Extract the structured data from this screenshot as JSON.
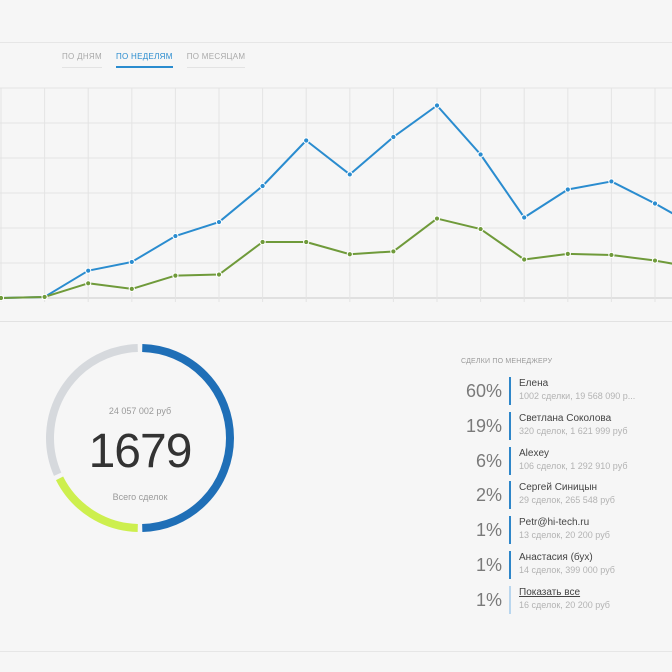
{
  "tabs": [
    {
      "label": "ПО ДНЯМ",
      "active": false
    },
    {
      "label": "ПО НЕДЕЛЯМ",
      "active": true
    },
    {
      "label": "ПО МЕСЯЦАМ",
      "active": false
    }
  ],
  "chart_data": {
    "type": "line",
    "x": [
      1,
      2,
      3,
      4,
      5,
      6,
      7,
      8,
      9,
      10,
      11,
      12,
      13,
      14,
      15,
      16,
      17
    ],
    "ylim": [
      0,
      6
    ],
    "grid": true,
    "series": [
      {
        "color": "#2a8ccf",
        "values": [
          0.0,
          0.03,
          0.78,
          1.03,
          1.77,
          2.17,
          3.2,
          4.5,
          3.53,
          4.6,
          5.5,
          4.1,
          2.3,
          3.1,
          3.33,
          2.7,
          2.0
        ]
      },
      {
        "color": "#6f9a3a",
        "values": [
          0.0,
          0.03,
          0.42,
          0.26,
          0.64,
          0.67,
          1.6,
          1.6,
          1.25,
          1.33,
          2.27,
          1.97,
          1.1,
          1.26,
          1.23,
          1.07,
          0.85
        ]
      }
    ]
  },
  "summary": {
    "amount": "24 057 002 руб",
    "total": "1679",
    "caption": "Всего сделок",
    "donut_segments": [
      {
        "color": "#1f6fb7",
        "fraction": 0.5
      },
      {
        "color": "#cdef4e",
        "fraction": 0.18
      },
      {
        "color": "#d6d9dd",
        "fraction": 0.32
      }
    ]
  },
  "managers": {
    "title": "СДЕЛКИ ПО МЕНЕДЖЕРУ",
    "items": [
      {
        "percent": "60%",
        "name": "Елена",
        "detail": "1002 сделки, 19 568 090 р..."
      },
      {
        "percent": "19%",
        "name": "Светлана Соколова",
        "detail": "320 сделок, 1 621 999 руб"
      },
      {
        "percent": "6%",
        "name": "Alexey",
        "detail": "106 сделок, 1 292 910 руб"
      },
      {
        "percent": "2%",
        "name": "Сергей Синицын",
        "detail": "29 сделок, 265 548 руб"
      },
      {
        "percent": "1%",
        "name": "Petr@hi-tech.ru",
        "detail": "13 сделок, 20 200 руб"
      },
      {
        "percent": "1%",
        "name": "Анастасия (бух)",
        "detail": "14 сделок, 399 000 руб"
      },
      {
        "percent": "1%",
        "name": "Показать все",
        "detail": "16 сделок, 20 200 руб"
      }
    ]
  }
}
